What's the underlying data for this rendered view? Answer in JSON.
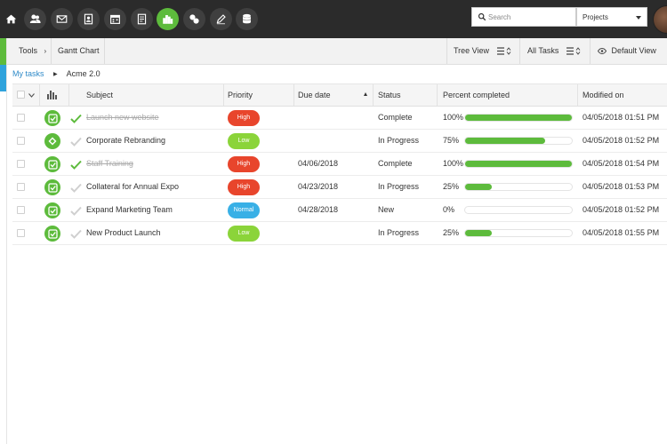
{
  "colors": {
    "accent": "#5dbb3c",
    "link": "#2f8ac8",
    "high": "#e8452c",
    "low": "#8bd43a",
    "normal": "#39b0e6",
    "topbar": "#2b2b2b"
  },
  "nav": {
    "icons": [
      "home-icon",
      "users-icon",
      "mail-icon",
      "contact-card-icon",
      "calendar-icon",
      "notes-icon",
      "reports-icon",
      "link-icon",
      "edit-icon",
      "database-icon"
    ],
    "active": "reports-icon"
  },
  "search": {
    "placeholder": "Search",
    "scope": "Projects"
  },
  "toolbar": {
    "tools": "Tools",
    "gantt": "Gantt Chart",
    "tree_view": "Tree View",
    "all_tasks": "All Tasks",
    "default_view": "Default View"
  },
  "breadcrumb": {
    "root": "My tasks",
    "current": "Acme 2.0"
  },
  "table": {
    "headers": {
      "subject": "Subject",
      "priority": "Priority",
      "due_date": "Due date",
      "status": "Status",
      "percent": "Percent completed",
      "modified": "Modified on"
    },
    "rows": [
      {
        "subject": "Launch new website",
        "priority": "High",
        "due_date": "",
        "status": "Complete",
        "percent_label": "100%",
        "percent": 100,
        "modified": "04/05/2018 01:51 PM",
        "done": true,
        "icon": "checklist-icon"
      },
      {
        "subject": "Corporate Rebranding",
        "priority": "Low",
        "due_date": "",
        "status": "In Progress",
        "percent_label": "75%",
        "percent": 75,
        "modified": "04/05/2018 01:52 PM",
        "done": false,
        "icon": "milestone-icon"
      },
      {
        "subject": "Staff Training",
        "priority": "High",
        "due_date": "04/06/2018",
        "status": "Complete",
        "percent_label": "100%",
        "percent": 100,
        "modified": "04/05/2018 01:54 PM",
        "done": true,
        "icon": "checklist-icon"
      },
      {
        "subject": "Collateral for Annual Expo",
        "priority": "High",
        "due_date": "04/23/2018",
        "status": "In Progress",
        "percent_label": "25%",
        "percent": 25,
        "modified": "04/05/2018 01:53 PM",
        "done": false,
        "icon": "checklist-icon"
      },
      {
        "subject": "Expand Marketing Team",
        "priority": "Normal",
        "due_date": "04/28/2018",
        "status": "New",
        "percent_label": "0%",
        "percent": 0,
        "modified": "04/05/2018 01:52 PM",
        "done": false,
        "icon": "checklist-icon"
      },
      {
        "subject": "New Product Launch",
        "priority": "Low",
        "due_date": "",
        "status": "In Progress",
        "percent_label": "25%",
        "percent": 25,
        "modified": "04/05/2018 01:55 PM",
        "done": false,
        "icon": "checklist-icon"
      }
    ]
  }
}
